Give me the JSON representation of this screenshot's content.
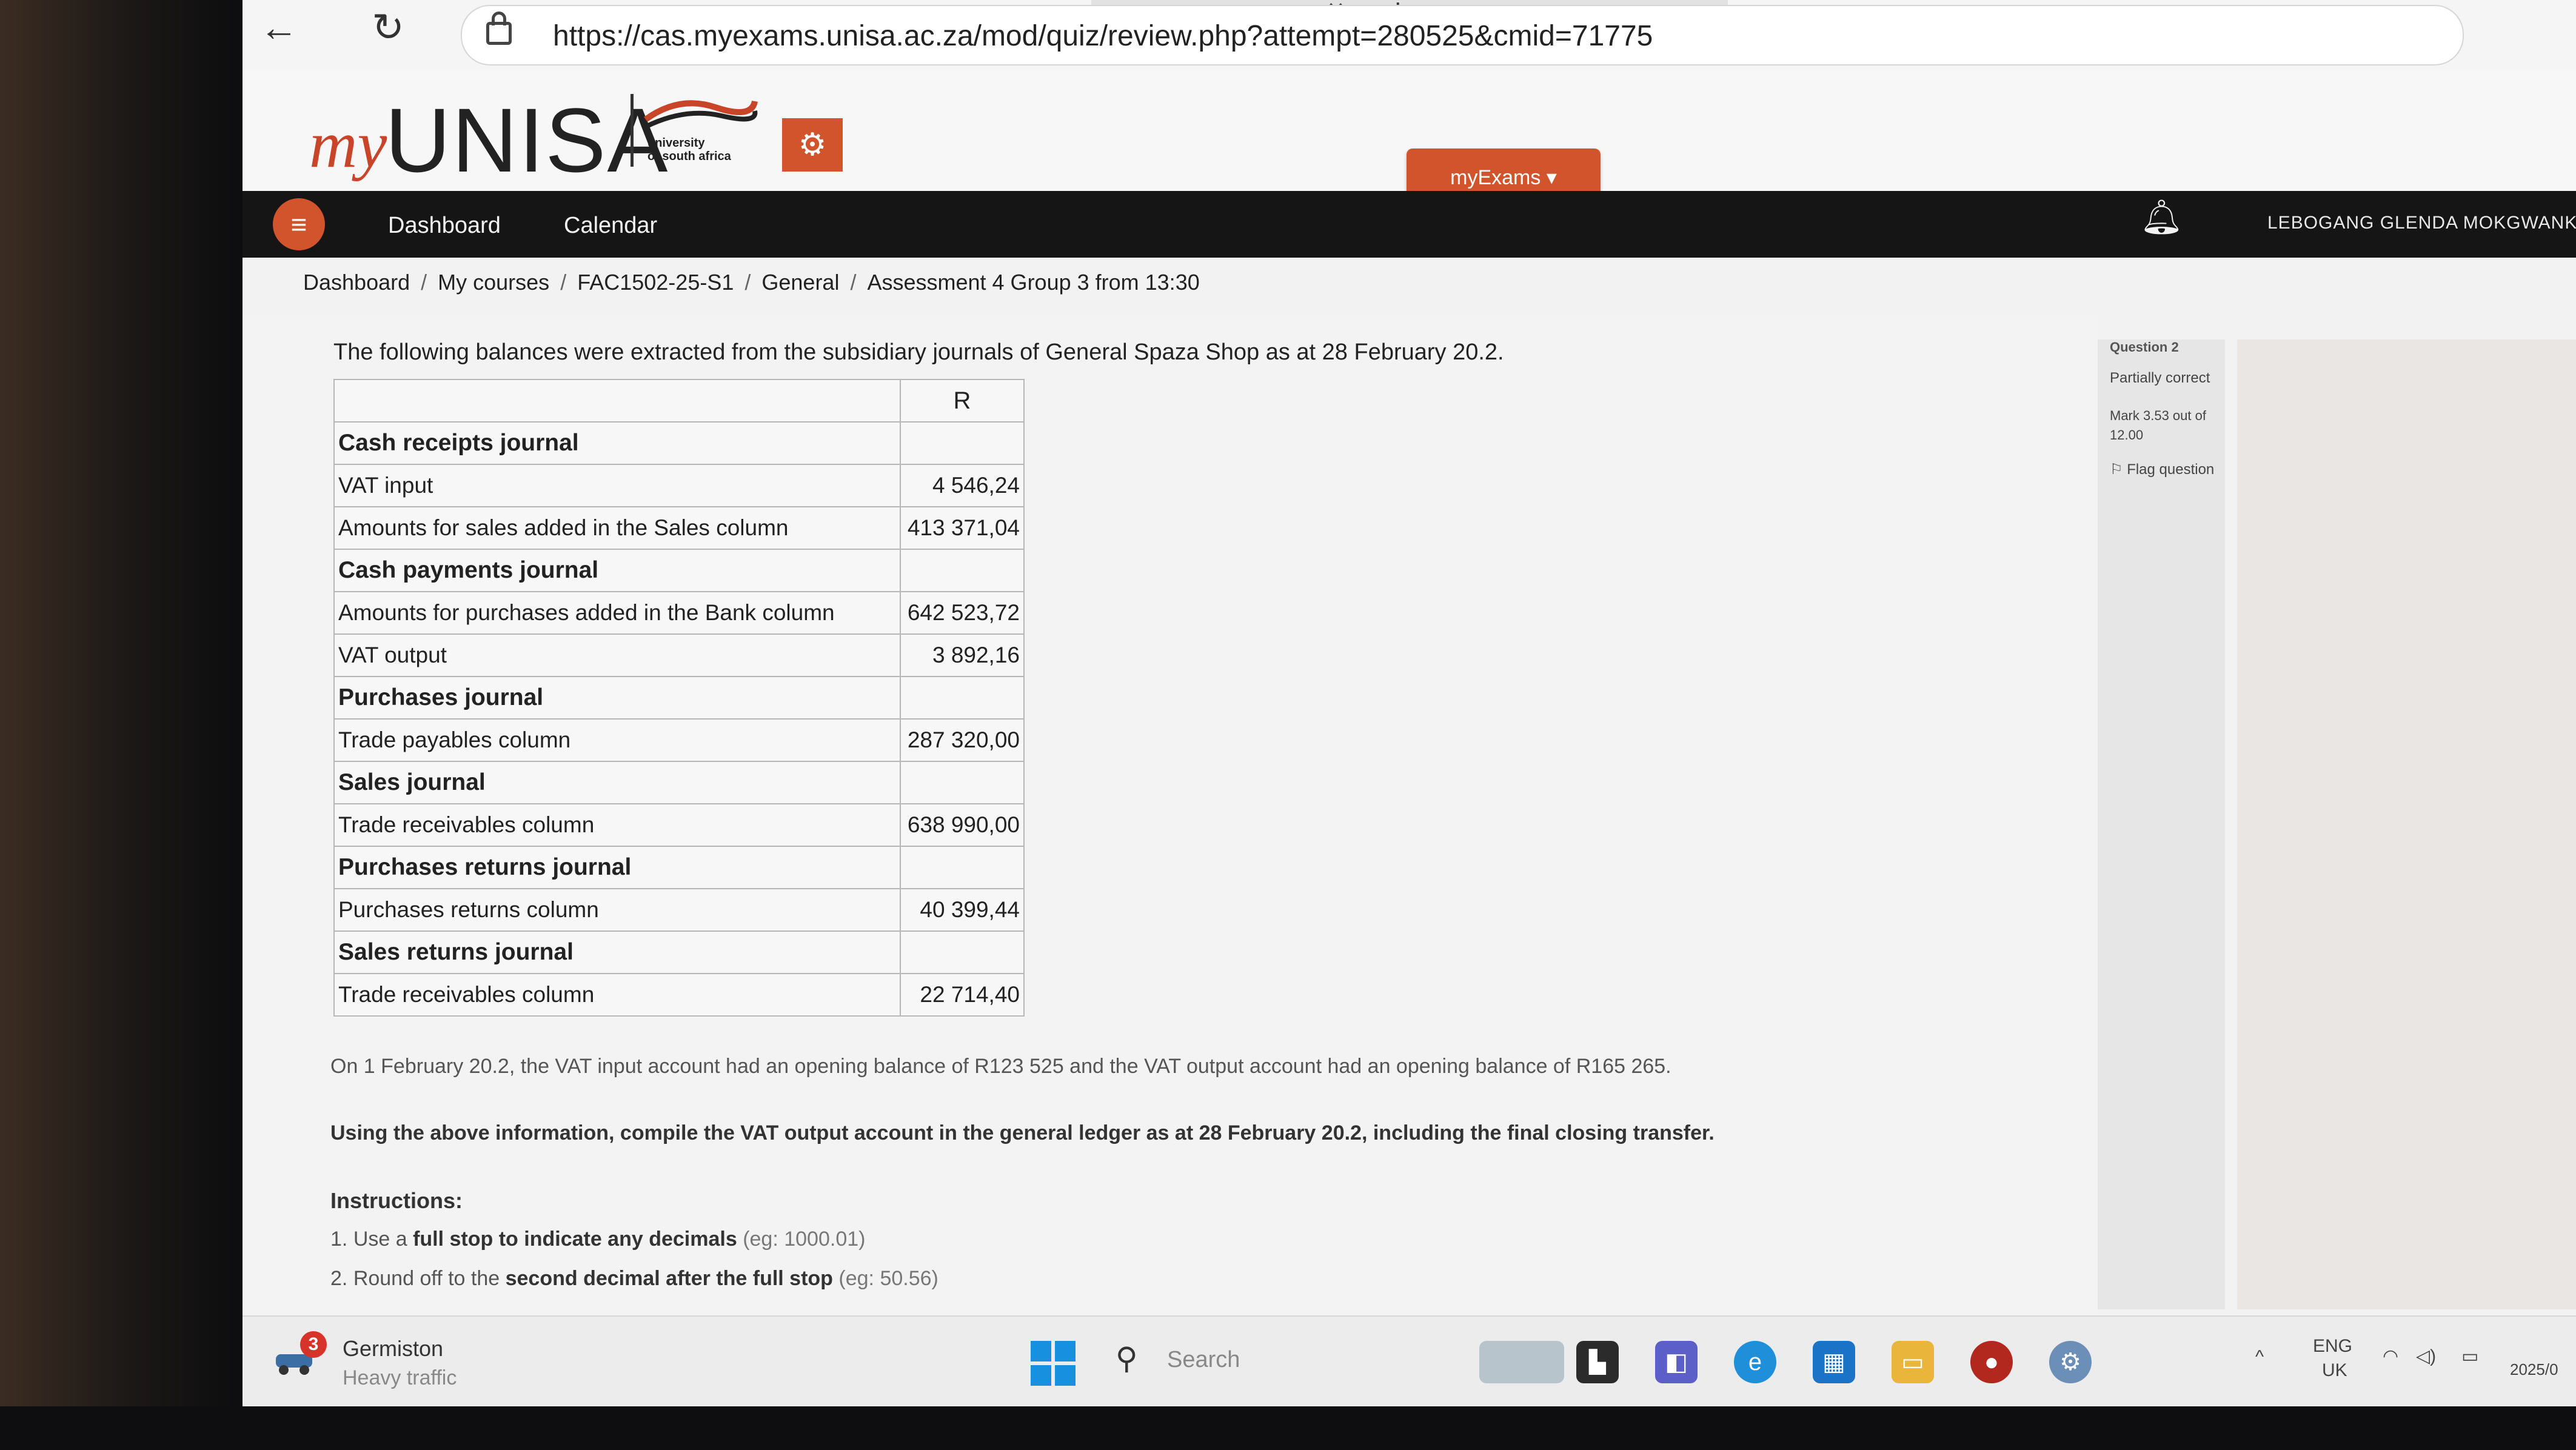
{
  "browser": {
    "url": "https://cas.myexams.unisa.ac.za/mod/quiz/review.php?attempt=280525&cmid=71775"
  },
  "header": {
    "logo_my": "my",
    "logo_unisa": "UNISA",
    "logo_sub_1": "university",
    "logo_sub_2": "of south africa",
    "myexams_label": "myExams ▾"
  },
  "navbar": {
    "dashboard": "Dashboard",
    "calendar": "Calendar",
    "username": "LEBOGANG GLENDA MOKGWANKGW"
  },
  "breadcrumb": [
    "Dashboard",
    "My courses",
    "FAC1502-25-S1",
    "General",
    "Assessment 4 Group 3 from 13:30"
  ],
  "question": {
    "intro": "The following balances were extracted from the subsidiary journals of General Spaza Shop as at 28 February 20.2.",
    "amount_header": "R",
    "rows": [
      {
        "label": "Cash receipts journal",
        "amount": "",
        "section": true
      },
      {
        "label": "VAT input",
        "amount": "4 546,24",
        "section": false
      },
      {
        "label": "Amounts for sales added in the Sales column",
        "amount": "413 371,04",
        "section": false
      },
      {
        "label": "Cash payments journal",
        "amount": "",
        "section": true
      },
      {
        "label": "Amounts for purchases added in the Bank column",
        "amount": "642 523,72",
        "section": false
      },
      {
        "label": "VAT output",
        "amount": "3 892,16",
        "section": false
      },
      {
        "label": "Purchases journal",
        "amount": "",
        "section": true
      },
      {
        "label": "Trade payables column",
        "amount": "287 320,00",
        "section": false
      },
      {
        "label": "Sales journal",
        "amount": "",
        "section": true
      },
      {
        "label": "Trade receivables column",
        "amount": "638 990,00",
        "section": false
      },
      {
        "label": "Purchases returns journal",
        "amount": "",
        "section": true
      },
      {
        "label": "Purchases returns column",
        "amount": "40 399,44",
        "section": false
      },
      {
        "label": "Sales returns journal",
        "amount": "",
        "section": true
      },
      {
        "label": "Trade receivables column",
        "amount": "22 714,40",
        "section": false
      }
    ],
    "opening_note": "On 1 February 20.2, the VAT input account had an opening balance of R123 525 and the VAT output account had an opening balance of R165 265.",
    "task": "Using the above information, compile the VAT output account in the general ledger as at 28 February 20.2, including the final closing transfer.",
    "instructions_title": "Instructions:",
    "instructions": [
      {
        "num": "1.",
        "pre": "Use a ",
        "bold": "full stop to indicate any decimals",
        "eg": "(eg: 1000.01)"
      },
      {
        "num": "2.",
        "pre": "Round off to the ",
        "bold": "second decimal after the full stop",
        "eg": "(eg: 50.56)"
      }
    ]
  },
  "quiz_info": {
    "question_label": "Question 2",
    "state": "Partially correct",
    "mark": "Mark 3.53 out of 12.00",
    "flag": "Flag question"
  },
  "taskbar": {
    "weather_count": "3",
    "weather_city": "Germiston",
    "weather_status": "Heavy traffic",
    "search_placeholder": "Search",
    "lang_1": "ENG",
    "lang_2": "UK",
    "date_partial": "2025/0"
  },
  "colors": {
    "brand": "#d2542d",
    "navbar": "#151515"
  }
}
